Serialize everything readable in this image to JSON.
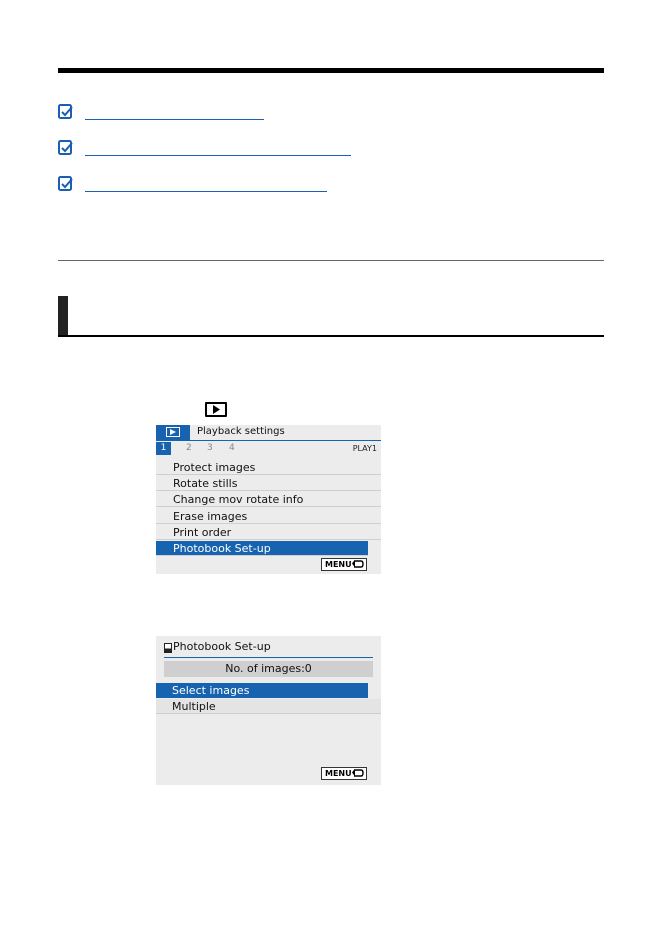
{
  "screen1": {
    "header_title": "Playback settings",
    "tabs": [
      "1",
      "2",
      "3",
      "4"
    ],
    "tab_code": "PLAY1",
    "items": [
      "Protect images",
      "Rotate stills",
      "Change mov rotate info",
      "Erase images",
      "Print order",
      "Photobook Set-up"
    ],
    "selected_item": "Photobook Set-up",
    "menu_button": "MENU"
  },
  "screen2": {
    "title": "Photobook Set-up",
    "count": "No. of images:0",
    "items": [
      "Select images",
      "Multiple"
    ],
    "selected_item": "Select images",
    "menu_button": "MENU"
  },
  "colors": {
    "accent": "#1763b0",
    "link": "#1a5fb4",
    "screen_bg": "#ececec"
  },
  "icons": {
    "link_bullet": "checkbox-check-icon",
    "playback_tab": "playback-icon",
    "back": "return-arrow-icon"
  }
}
